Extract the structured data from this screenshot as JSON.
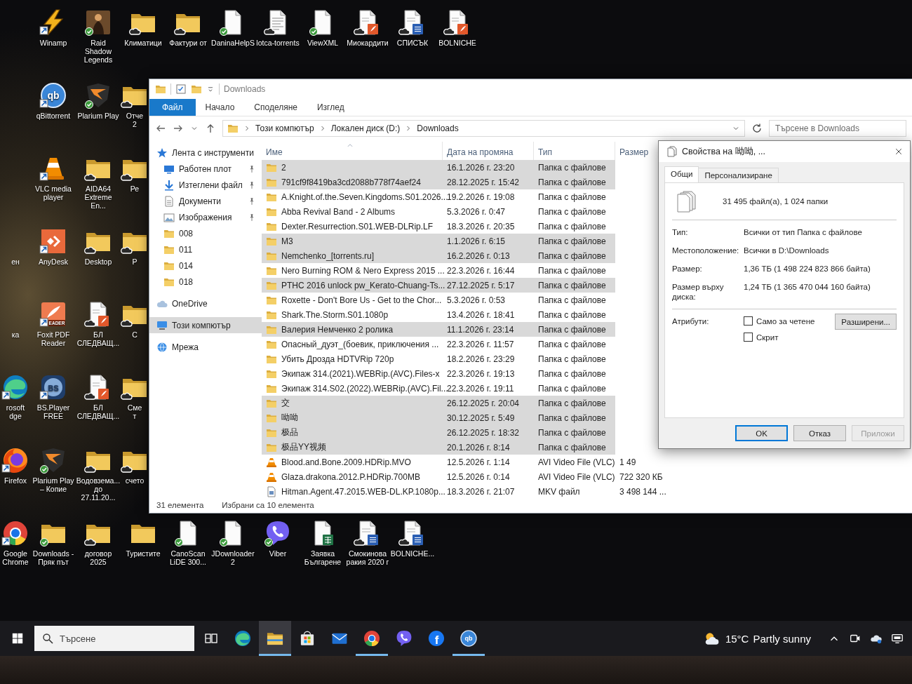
{
  "desktop": {
    "columns": [
      {
        "icons": [
          {
            "label": "ен",
            "kind": "none",
            "shortcut": false,
            "cloud": false,
            "synced": false
          },
          {
            "label": "ка",
            "kind": "none",
            "shortcut": false,
            "cloud": false,
            "synced": false
          },
          {
            "label": "rosoft\ndge",
            "kind": "edge",
            "shortcut": true,
            "cloud": false,
            "synced": false
          },
          {
            "label": "Firefox",
            "kind": "firefox",
            "shortcut": true,
            "cloud": false,
            "synced": false
          },
          {
            "label": "Google Chrome",
            "kind": "chrome",
            "shortcut": true,
            "cloud": false,
            "synced": false
          }
        ]
      },
      {
        "icons": [
          {
            "label": "Winamp",
            "kind": "winamp",
            "shortcut": true,
            "cloud": false,
            "synced": false
          },
          {
            "label": "qBittorrent",
            "kind": "qbittorrent",
            "shortcut": true,
            "cloud": false,
            "synced": false,
            "logo_text": "qb"
          },
          {
            "label": "VLC media player",
            "kind": "vlc",
            "shortcut": true,
            "cloud": false,
            "synced": false
          },
          {
            "label": "AnyDesk",
            "kind": "anydesk",
            "shortcut": true,
            "cloud": false,
            "synced": false
          },
          {
            "label": "Foxit PDF Reader",
            "kind": "foxit",
            "shortcut": true,
            "cloud": false,
            "synced": false,
            "logo_text": "EADER"
          },
          {
            "label": "BS.Player FREE",
            "kind": "bsplayer",
            "shortcut": true,
            "cloud": false,
            "synced": false,
            "logo_text": "BS"
          },
          {
            "label": "Plarium Play – Копие",
            "kind": "plarium",
            "shortcut": false,
            "cloud": false,
            "synced": true
          },
          {
            "label": "Downloads - Пряк път",
            "kind": "folder",
            "shortcut": false,
            "cloud": false,
            "synced": true
          }
        ]
      },
      {
        "icons": [
          {
            "label": "Raid Shadow Legends",
            "kind": "game",
            "shortcut": false,
            "cloud": false,
            "synced": true
          },
          {
            "label": "Plarium Play",
            "kind": "plarium",
            "shortcut": false,
            "cloud": false,
            "synced": true
          },
          {
            "label": "AIDA64 Extreme En...",
            "kind": "folder",
            "shortcut": false,
            "cloud": true,
            "synced": false
          },
          {
            "label": "Desktop",
            "kind": "folder",
            "shortcut": false,
            "cloud": true,
            "synced": false
          },
          {
            "label": "БЛ СЛЕДВАЩ...",
            "kind": "pdf",
            "shortcut": false,
            "cloud": true,
            "synced": false
          },
          {
            "label": "БЛ СЛЕДВАЩ...",
            "kind": "pdf",
            "shortcut": false,
            "cloud": true,
            "synced": false
          },
          {
            "label": "Водовзема... до 27.11.20...",
            "kind": "folder",
            "shortcut": false,
            "cloud": true,
            "synced": false
          },
          {
            "label": "договор 2025",
            "kind": "folder",
            "shortcut": false,
            "cloud": true,
            "synced": false
          }
        ]
      },
      {
        "icons": [
          {
            "label": "Климатици",
            "kind": "folder",
            "shortcut": false,
            "cloud": true,
            "synced": false
          },
          {
            "label": "Отче\n2",
            "kind": "folder",
            "shortcut": false,
            "cloud": true,
            "synced": false
          },
          {
            "label": "Ре",
            "kind": "folder",
            "shortcut": false,
            "cloud": true,
            "synced": false
          },
          {
            "label": "Р",
            "kind": "folder",
            "shortcut": false,
            "cloud": true,
            "synced": false
          },
          {
            "label": "С",
            "kind": "folder",
            "shortcut": false,
            "cloud": true,
            "synced": false
          },
          {
            "label": "Сме\nт",
            "kind": "folder",
            "shortcut": false,
            "cloud": true,
            "synced": false
          },
          {
            "label": "счето",
            "kind": "folder",
            "shortcut": false,
            "cloud": true,
            "synced": false
          },
          {
            "label": "Туристите",
            "kind": "folder",
            "shortcut": false,
            "cloud": false,
            "synced": false
          }
        ]
      }
    ],
    "top_row": [
      {
        "label": "Фактури от",
        "kind": "folder",
        "shortcut": false,
        "cloud": true,
        "synced": false
      },
      {
        "label": "DaninaHelpS",
        "kind": "file",
        "shortcut": false,
        "cloud": false,
        "synced": true
      },
      {
        "label": "lotca-torrents",
        "kind": "scan",
        "shortcut": false,
        "cloud": true,
        "synced": false
      },
      {
        "label": "ViewXML",
        "kind": "file",
        "shortcut": false,
        "cloud": false,
        "synced": true
      },
      {
        "label": "Миокардити",
        "kind": "pdf",
        "shortcut": false,
        "cloud": true,
        "synced": false
      },
      {
        "label": "СПИСЪК",
        "kind": "word",
        "shortcut": false,
        "cloud": true,
        "synced": false
      },
      {
        "label": "BOLNICHE",
        "kind": "pdf",
        "shortcut": false,
        "cloud": true,
        "synced": false
      }
    ],
    "bottom_row": [
      {
        "label": "CanoScan LiDE 300...",
        "kind": "file",
        "shortcut": false,
        "cloud": false,
        "synced": true
      },
      {
        "label": "JDownloader 2",
        "kind": "file",
        "shortcut": false,
        "cloud": false,
        "synced": true
      },
      {
        "label": "Viber",
        "kind": "viber",
        "shortcut": false,
        "cloud": false,
        "synced": true
      },
      {
        "label": "Заявка Българене",
        "kind": "excel",
        "shortcut": false,
        "cloud": false,
        "synced": false
      },
      {
        "label": "Смокинова ракия 2020 г",
        "kind": "word",
        "shortcut": false,
        "cloud": true,
        "synced": false
      },
      {
        "label": "BOLNICHE...",
        "kind": "word",
        "shortcut": false,
        "cloud": true,
        "synced": false
      }
    ]
  },
  "explorer": {
    "title": "Downloads",
    "ribbon_tabs": [
      {
        "label": "Файл",
        "kind": "menu"
      },
      {
        "label": "Начало",
        "kind": "tab"
      },
      {
        "label": "Споделяне",
        "kind": "tab"
      },
      {
        "label": "Изглед",
        "kind": "tab"
      }
    ],
    "address": [
      "Този компютър",
      "Локален диск (D:)",
      "Downloads"
    ],
    "search": {
      "placeholder": "Търсене в Downloads"
    },
    "nav": [
      {
        "label": "Лента с инструменти",
        "kind": "star",
        "pinned": false,
        "selected": false,
        "children": [
          {
            "label": "Работен плот",
            "kind": "desktop",
            "pinned": true,
            "selected": false
          },
          {
            "label": "Изтеглени файл",
            "kind": "downloads",
            "pinned": true,
            "selected": false
          },
          {
            "label": "Документи",
            "kind": "documents",
            "pinned": true,
            "selected": false
          },
          {
            "label": "Изображения",
            "kind": "pictures",
            "pinned": true,
            "selected": false
          },
          {
            "label": "008",
            "kind": "folder",
            "pinned": false,
            "selected": false
          },
          {
            "label": "011",
            "kind": "folder",
            "pinned": false,
            "selected": false
          },
          {
            "label": "014",
            "kind": "folder",
            "pinned": false,
            "selected": false
          },
          {
            "label": "018",
            "kind": "folder",
            "pinned": false,
            "selected": false
          }
        ]
      },
      {
        "label": "OneDrive",
        "kind": "cloud",
        "pinned": false,
        "selected": false
      },
      {
        "label": "Този компютър",
        "kind": "computer",
        "pinned": false,
        "selected": true
      },
      {
        "label": "Мрежа",
        "kind": "network",
        "pinned": false,
        "selected": false
      }
    ],
    "columns": [
      {
        "label": "Име",
        "sorted": true
      },
      {
        "label": "Дата на промяна",
        "sorted": false
      },
      {
        "label": "Тип",
        "sorted": false
      },
      {
        "label": "Размер",
        "sorted": false
      }
    ],
    "rows": [
      {
        "name": "2",
        "kind": "folder",
        "date": "16.1.2026 г. 23:20",
        "type": "Папка с файлове",
        "selected": true
      },
      {
        "name": "791cf9f8419ba3cd2088b778f74aef24",
        "kind": "folder",
        "date": "28.12.2025 г. 15:42",
        "type": "Папка с файлове",
        "selected": true
      },
      {
        "name": "A.Knight.of.the.Seven.Kingdoms.S01.2026...",
        "kind": "folder",
        "date": "19.2.2026 г. 19:08",
        "type": "Папка с файлове",
        "selected": false
      },
      {
        "name": "Abba Revival Band - 2 Albums",
        "kind": "folder",
        "date": "5.3.2026 г. 0:47",
        "type": "Папка с файлове",
        "selected": false
      },
      {
        "name": "Dexter.Resurrection.S01.WEB-DLRip.LF",
        "kind": "folder",
        "date": "18.3.2026 г. 20:35",
        "type": "Папка с файлове",
        "selected": false
      },
      {
        "name": "M3",
        "kind": "folder",
        "date": "1.1.2026 г. 6:15",
        "type": "Папка с файлове",
        "selected": true
      },
      {
        "name": "Nemchenko_[torrents.ru]",
        "kind": "folder",
        "date": "16.2.2026 г. 0:13",
        "type": "Папка с файлове",
        "selected": true
      },
      {
        "name": "Nero Burning ROM & Nero Express 2015 ...",
        "kind": "folder",
        "date": "22.3.2026 г. 16:44",
        "type": "Папка с файлове",
        "selected": false
      },
      {
        "name": "PTHC 2016 unlock pw_Kerato-Chuang-Ts...",
        "kind": "folder",
        "date": "27.12.2025 г. 5:17",
        "type": "Папка с файлове",
        "selected": true
      },
      {
        "name": "Roxette - Don't Bore Us - Get to the Chor...",
        "kind": "folder",
        "date": "5.3.2026 г. 0:53",
        "type": "Папка с файлове",
        "selected": false
      },
      {
        "name": "Shark.The.Storm.S01.1080p",
        "kind": "folder",
        "date": "13.4.2026 г. 18:41",
        "type": "Папка с файлове",
        "selected": false
      },
      {
        "name": "Валерия Немченко 2 ролика",
        "kind": "folder",
        "date": "11.1.2026 г. 23:14",
        "type": "Папка с файлове",
        "selected": true
      },
      {
        "name": "Опасный_дуэт_(боевик, приключения ...",
        "kind": "folder",
        "date": "22.3.2026 г. 11:57",
        "type": "Папка с файлове",
        "selected": false
      },
      {
        "name": "Убить Дрозда HDTVRip 720p",
        "kind": "folder",
        "date": "18.2.2026 г. 23:29",
        "type": "Папка с файлове",
        "selected": false
      },
      {
        "name": "Экипаж 314.(2021).WEBRip.(AVC).Files-x",
        "kind": "folder",
        "date": "22.3.2026 г. 19:13",
        "type": "Папка с файлове",
        "selected": false
      },
      {
        "name": "Экипаж 314.S02.(2022).WEBRip.(AVC).Fil...",
        "kind": "folder",
        "date": "22.3.2026 г. 19:11",
        "type": "Папка с файлове",
        "selected": false
      },
      {
        "name": "交",
        "kind": "folder",
        "date": "26.12.2025 г. 20:04",
        "type": "Папка с файлове",
        "selected": true
      },
      {
        "name": "呦呦",
        "kind": "folder",
        "date": "30.12.2025 г. 5:49",
        "type": "Папка с файлове",
        "selected": true
      },
      {
        "name": "极品",
        "kind": "folder",
        "date": "26.12.2025 г. 18:32",
        "type": "Папка с файлове",
        "selected": true
      },
      {
        "name": "极品YY视频",
        "kind": "folder",
        "date": "20.1.2026 г. 8:14",
        "type": "Папка с файлове",
        "selected": true
      },
      {
        "name": "Blood.and.Bone.2009.HDRip.MVO",
        "kind": "video",
        "date": "12.5.2026 г. 1:14",
        "type": "AVI Video File (VLC)",
        "size": "1 49",
        "selected": false
      },
      {
        "name": "Glaza.drakona.2012.P.HDRip.700MB",
        "kind": "video",
        "date": "12.5.2026 г. 0:14",
        "type": "AVI Video File (VLC)",
        "size": "722 320 КБ",
        "selected": false
      },
      {
        "name": "Hitman.Agent.47.2015.WEB-DL.KP.1080p...",
        "kind": "mkv",
        "date": "18.3.2026 г. 21:07",
        "type": "MKV файл",
        "size": "3 498 144 ...",
        "selected": false
      }
    ],
    "status": {
      "count": "31 елемента",
      "selection": "Избрани са 10 елемента"
    }
  },
  "properties": {
    "title": "Свойства на 呦呦, ...",
    "tabs": [
      {
        "label": "Общи",
        "selected": true
      },
      {
        "label": "Персонализиране",
        "selected": false
      }
    ],
    "summary": "31 495 файл(а), 1 024 папки",
    "fields": [
      {
        "label": "Тип:",
        "value": "Всички от тип Папка с файлове"
      },
      {
        "label": "Местоположение:",
        "value": "Всички в D:\\Downloads"
      },
      {
        "label": "Размер:",
        "value": "1,36 ТБ (1 498 224 823 866 байта)"
      },
      {
        "label": "Размер върху диска:",
        "value": "1,24 ТБ (1 365 470 044 160 байта)"
      }
    ],
    "attributes_label": "Атрибути:",
    "attributes": [
      {
        "label": "Само за четене",
        "checked": false
      },
      {
        "label": "Скрит",
        "checked": false
      }
    ],
    "advanced_button": "Разширени...",
    "buttons": [
      {
        "label": "OK",
        "default": true,
        "disabled": false
      },
      {
        "label": "Отказ",
        "default": false,
        "disabled": false
      },
      {
        "label": "Приложи",
        "default": false,
        "disabled": true
      }
    ]
  },
  "taskbar": {
    "search": {
      "placeholder": "Търсене"
    },
    "apps": [
      {
        "kind": "edge",
        "running": false,
        "active": false
      },
      {
        "kind": "explorer",
        "running": true,
        "active": true
      },
      {
        "kind": "store",
        "running": false,
        "active": false
      },
      {
        "kind": "mail",
        "running": false,
        "active": false
      },
      {
        "kind": "chrome",
        "running": true,
        "active": false
      },
      {
        "kind": "viber",
        "running": false,
        "active": false
      },
      {
        "kind": "facebook",
        "running": false,
        "active": false,
        "logo_text": "f"
      },
      {
        "kind": "qbittorrent",
        "running": true,
        "active": false,
        "logo_text": "qb"
      }
    ],
    "weather": {
      "temperature": "15°C",
      "condition": "Partly sunny"
    },
    "tray": [
      {
        "kind": "chevron"
      },
      {
        "kind": "meet"
      },
      {
        "kind": "onedrive"
      },
      {
        "kind": "display"
      }
    ]
  }
}
